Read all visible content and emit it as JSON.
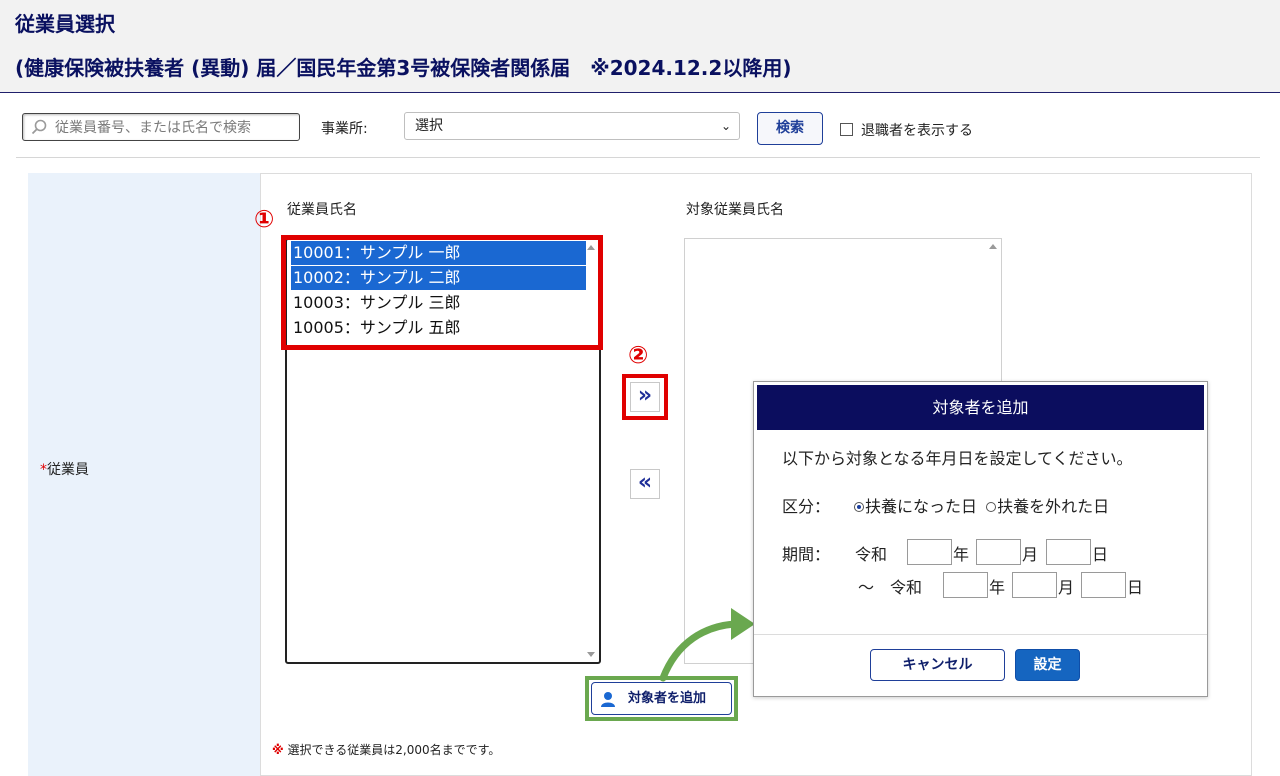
{
  "header": {
    "title": "従業員選択",
    "subtitle": "(健康保険被扶養者 (異動) 届／国民年金第3号被保険者関係届　※2024.12.2以降用)"
  },
  "search": {
    "placeholder": "従業員番号、または氏名で検索",
    "office_label": "事業所:",
    "office_selected": "選択",
    "search_button": "検索",
    "show_retired_label": "退職者を表示する"
  },
  "form": {
    "employee_field_label": "従業員",
    "required_mark": "*",
    "left_list_label": "従業員氏名",
    "right_list_label": "対象従業員氏名",
    "employees": [
      {
        "label": "10001：サンプル 一郎",
        "selected": true
      },
      {
        "label": "10002：サンプル 二郎",
        "selected": true
      },
      {
        "label": "10003：サンプル 三郎",
        "selected": false
      },
      {
        "label": "10005：サンプル 五郎",
        "selected": false
      }
    ],
    "move_right": "»",
    "move_left": "«",
    "add_target_button": "対象者を追加",
    "note_mark": "※",
    "note": "選択できる従業員は2,000名までです。"
  },
  "annotations": {
    "step1": "①",
    "step2": "②",
    "colors": {
      "step_highlight": "#e00000",
      "add_highlight": "#6aa84f"
    }
  },
  "modal": {
    "title": "対象者を追加",
    "message": "以下から対象となる年月日を設定してください。",
    "category_label": "区分：",
    "option_became": "扶養になった日",
    "option_left": "扶養を外れた日",
    "selected_option": "扶養になった日",
    "period_label": "期間：",
    "era": "令和",
    "year": "年",
    "month": "月",
    "day": "日",
    "tilde": "～",
    "cancel_button": "キャンセル",
    "set_button": "設定"
  },
  "colors": {
    "header_text": "#0a1160",
    "modal_header": "#0b0d5e",
    "selection": "#1a68d2",
    "primary_button": "#1565c0"
  }
}
